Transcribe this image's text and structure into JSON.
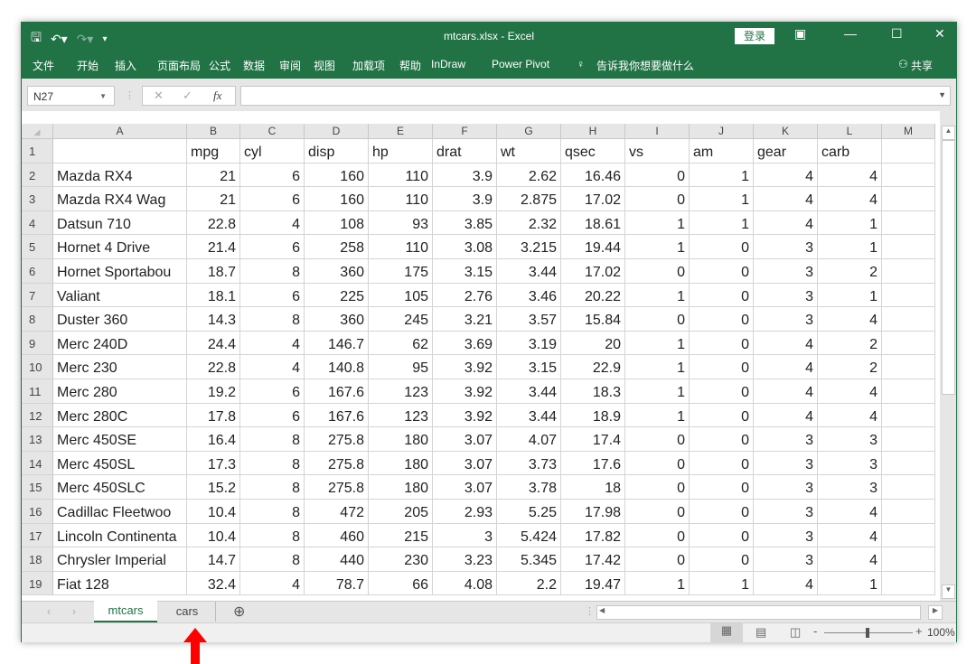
{
  "app": {
    "title": "mtcars.xlsx  -  Excel",
    "login_label": "登录"
  },
  "qat": {
    "save_icon": "save-icon",
    "undo_icon": "undo-icon",
    "redo_icon": "redo-icon",
    "customize_icon": "customize-icon"
  },
  "window_controls": {
    "ribbon_display": "▣",
    "minimize": "—",
    "maximize": "☐",
    "close": "✕"
  },
  "ribbon": {
    "tabs": [
      "文件",
      "开始",
      "插入",
      "页面布局",
      "公式",
      "数据",
      "审阅",
      "视图",
      "加载项",
      "帮助",
      "InDraw",
      "Power Pivot"
    ],
    "tell_me": "告诉我你想要做什么",
    "share": "共享"
  },
  "formula_bar": {
    "name_box": "N27",
    "formula": "",
    "fx_label": "fx",
    "cancel": "✕",
    "enter": "✓"
  },
  "sheet": {
    "columns": [
      "A",
      "B",
      "C",
      "D",
      "E",
      "F",
      "G",
      "H",
      "I",
      "J",
      "K",
      "L",
      "M"
    ],
    "row_numbers": [
      "1",
      "2",
      "3",
      "4",
      "5",
      "6",
      "7",
      "8",
      "9",
      "10",
      "11",
      "12",
      "13",
      "14",
      "15",
      "16",
      "17",
      "18",
      "19"
    ],
    "header_row": [
      "",
      "mpg",
      "cyl",
      "disp",
      "hp",
      "drat",
      "wt",
      "qsec",
      "vs",
      "am",
      "gear",
      "carb",
      ""
    ],
    "rows": [
      [
        "Mazda RX4",
        "21",
        "6",
        "160",
        "110",
        "3.9",
        "2.62",
        "16.46",
        "0",
        "1",
        "4",
        "4"
      ],
      [
        "Mazda RX4 Wag",
        "21",
        "6",
        "160",
        "110",
        "3.9",
        "2.875",
        "17.02",
        "0",
        "1",
        "4",
        "4"
      ],
      [
        "Datsun 710",
        "22.8",
        "4",
        "108",
        "93",
        "3.85",
        "2.32",
        "18.61",
        "1",
        "1",
        "4",
        "1"
      ],
      [
        "Hornet 4 Drive",
        "21.4",
        "6",
        "258",
        "110",
        "3.08",
        "3.215",
        "19.44",
        "1",
        "0",
        "3",
        "1"
      ],
      [
        "Hornet Sportabou",
        "18.7",
        "8",
        "360",
        "175",
        "3.15",
        "3.44",
        "17.02",
        "0",
        "0",
        "3",
        "2"
      ],
      [
        "Valiant",
        "18.1",
        "6",
        "225",
        "105",
        "2.76",
        "3.46",
        "20.22",
        "1",
        "0",
        "3",
        "1"
      ],
      [
        "Duster 360",
        "14.3",
        "8",
        "360",
        "245",
        "3.21",
        "3.57",
        "15.84",
        "0",
        "0",
        "3",
        "4"
      ],
      [
        "Merc 240D",
        "24.4",
        "4",
        "146.7",
        "62",
        "3.69",
        "3.19",
        "20",
        "1",
        "0",
        "4",
        "2"
      ],
      [
        "Merc 230",
        "22.8",
        "4",
        "140.8",
        "95",
        "3.92",
        "3.15",
        "22.9",
        "1",
        "0",
        "4",
        "2"
      ],
      [
        "Merc 280",
        "19.2",
        "6",
        "167.6",
        "123",
        "3.92",
        "3.44",
        "18.3",
        "1",
        "0",
        "4",
        "4"
      ],
      [
        "Merc 280C",
        "17.8",
        "6",
        "167.6",
        "123",
        "3.92",
        "3.44",
        "18.9",
        "1",
        "0",
        "4",
        "4"
      ],
      [
        "Merc 450SE",
        "16.4",
        "8",
        "275.8",
        "180",
        "3.07",
        "4.07",
        "17.4",
        "0",
        "0",
        "3",
        "3"
      ],
      [
        "Merc 450SL",
        "17.3",
        "8",
        "275.8",
        "180",
        "3.07",
        "3.73",
        "17.6",
        "0",
        "0",
        "3",
        "3"
      ],
      [
        "Merc 450SLC",
        "15.2",
        "8",
        "275.8",
        "180",
        "3.07",
        "3.78",
        "18",
        "0",
        "0",
        "3",
        "3"
      ],
      [
        "Cadillac Fleetwoo",
        "10.4",
        "8",
        "472",
        "205",
        "2.93",
        "5.25",
        "17.98",
        "0",
        "0",
        "3",
        "4"
      ],
      [
        "Lincoln Continenta",
        "10.4",
        "8",
        "460",
        "215",
        "3",
        "5.424",
        "17.82",
        "0",
        "0",
        "3",
        "4"
      ],
      [
        "Chrysler Imperial",
        "14.7",
        "8",
        "440",
        "230",
        "3.23",
        "5.345",
        "17.42",
        "0",
        "0",
        "3",
        "4"
      ],
      [
        "Fiat 128",
        "32.4",
        "4",
        "78.7",
        "66",
        "4.08",
        "2.2",
        "19.47",
        "1",
        "1",
        "4",
        "1"
      ]
    ]
  },
  "sheet_tabs": {
    "tabs": [
      "mtcars",
      "cars"
    ],
    "active": "mtcars",
    "add_icon": "⊕"
  },
  "status": {
    "zoom": "100%",
    "zoom_minus": "-",
    "zoom_plus": "+"
  },
  "annotation": {
    "arrow_color": "#ff0000"
  },
  "colors": {
    "brand": "#217346"
  }
}
